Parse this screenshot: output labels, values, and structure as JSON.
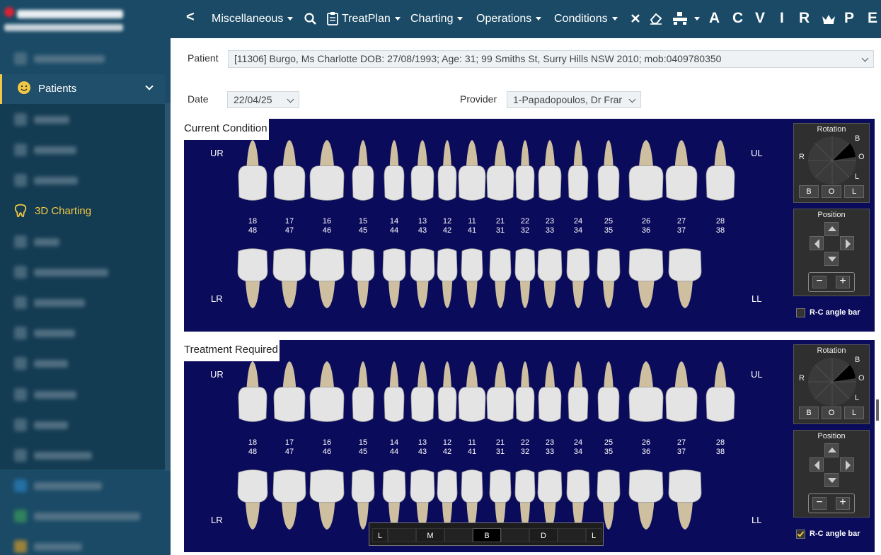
{
  "toolbar": {
    "back": "<",
    "miscellaneous": "Miscellaneous",
    "treatplan": "TreatPlan",
    "charting": "Charting",
    "operations": "Operations",
    "conditions": "Conditions",
    "letters": [
      "A",
      "C",
      "V",
      "I",
      "R",
      "P",
      "E"
    ]
  },
  "sidebar": {
    "patients": "Patients",
    "charting3d": "3D Charting"
  },
  "form": {
    "patient_label": "Patient",
    "patient_value": "[11306] Burgo, Ms Charlotte DOB: 27/08/1993; Age: 31; 99 Smiths St, Surry Hills NSW 2010; mob:0409780350",
    "date_label": "Date",
    "date_value": "22/04/25",
    "provider_label": "Provider",
    "provider_value": "1-Papadopoulos, Dr Frar"
  },
  "panels": {
    "current_title": "Current Condition",
    "treatment_title": "Treatment Required",
    "quad_ur": "UR",
    "quad_ul": "UL",
    "quad_lr": "LR",
    "quad_ll": "LL"
  },
  "teeth": {
    "upper": [
      "18",
      "17",
      "16",
      "15",
      "14",
      "13",
      "12",
      "11",
      "21",
      "22",
      "23",
      "24",
      "25",
      "26",
      "27",
      "28"
    ],
    "lower": [
      "48",
      "47",
      "46",
      "45",
      "44",
      "43",
      "42",
      "41",
      "31",
      "32",
      "33",
      "34",
      "35",
      "36",
      "37",
      "38"
    ]
  },
  "controls": {
    "rotation": "Rotation",
    "rot_b": "B",
    "rot_r": "R",
    "rot_o": "O",
    "rot_l": "L",
    "btn_b": "B",
    "btn_o": "O",
    "btn_l": "L",
    "position": "Position",
    "rc_angle_bar": "R-C angle bar"
  },
  "surface_bar": [
    "L",
    "M",
    "B",
    "D",
    "L"
  ]
}
